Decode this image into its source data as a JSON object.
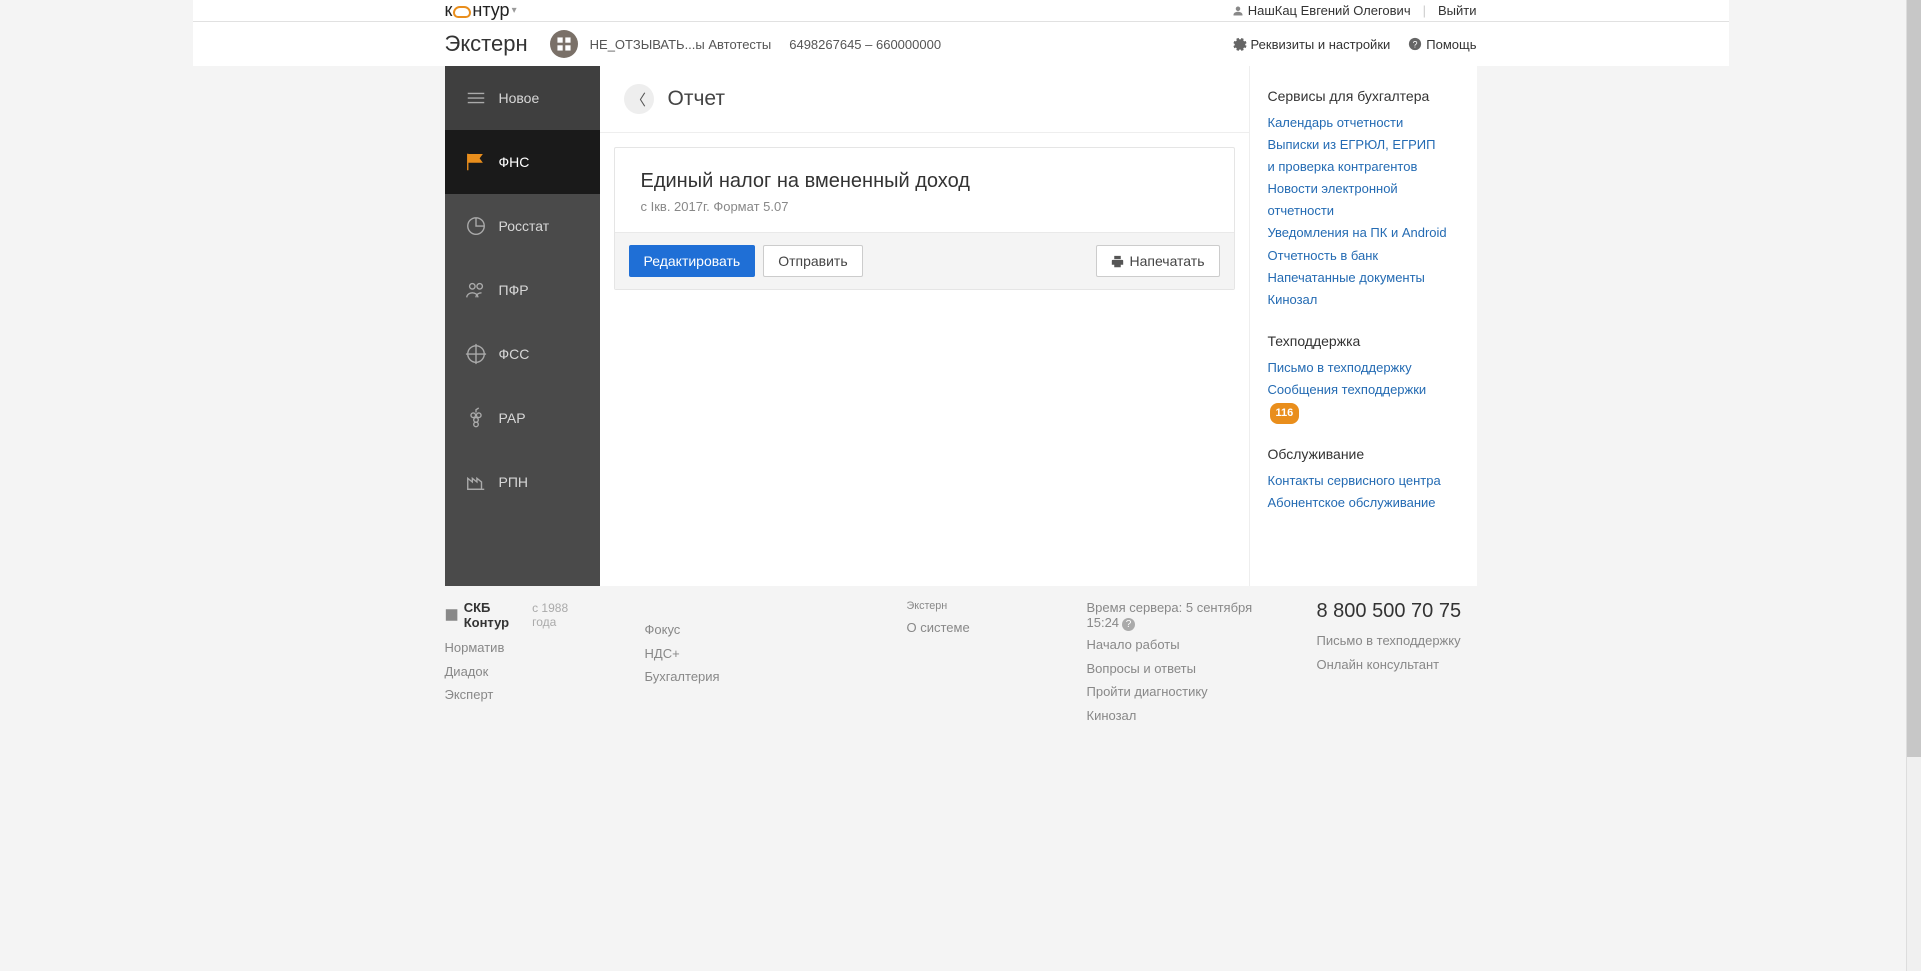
{
  "topbar": {
    "user": "НашКац Евгений Олегович",
    "logout": "Выйти"
  },
  "header": {
    "app": "Экстерн",
    "org": "НЕ_ОТЗЫВАТЬ...ы Автотесты",
    "orgnum": "6498267645 – 660000000",
    "settings": "Реквизиты и настройки",
    "help": "Помощь"
  },
  "nav": {
    "new": "Новое",
    "fns": "ФНС",
    "rosstat": "Росстат",
    "pfr": "ПФР",
    "fss": "ФСС",
    "rar": "РАР",
    "rpn": "РПН"
  },
  "page": {
    "title": "Отчет"
  },
  "report": {
    "title": "Единый налог на вмененный доход",
    "sub": "с Iкв. 2017г. Формат 5.07",
    "edit": "Редактировать",
    "send": "Отправить",
    "print": "Напечатать"
  },
  "rpanel": {
    "h1": "Сервисы для бухгалтера",
    "l1": "Календарь отчетности",
    "l2a": "Выписки из ЕГРЮЛ, ЕГРИП",
    "l2b": "и проверка контрагентов",
    "l3": "Новости электронной отчетности",
    "l4": "Уведомления на ПК и Android",
    "l5": "Отчетность в банк",
    "l6": "Напечатанные документы",
    "l7": "Кинозал",
    "h2": "Техподдержка",
    "l8": "Письмо в техподдержку",
    "l9": "Сообщения техподдержки",
    "badge": "116",
    "h3": "Обслуживание",
    "l10": "Контакты сервисного центра",
    "l11": "Абонентское обслуживание"
  },
  "footer": {
    "brand": "СКБ Контур",
    "since": "с 1988 года",
    "c1a": "Норматив",
    "c1b": "Диадок",
    "c1c": "Эксперт",
    "c2a": "Фокус",
    "c2b": "НДС+",
    "c2c": "Бухгалтерия",
    "extern": "Экстерн",
    "about": "О системе",
    "srvtime": "Время сервера: 5 сентября 15:24",
    "start": "Начало работы",
    "faq": "Вопросы и ответы",
    "diag": "Пройти диагностику",
    "cinema": "Кинозал",
    "phone": "8 800 500 70 75",
    "supmail": "Письмо в техподдержку",
    "consult": "Онлайн консультант"
  }
}
